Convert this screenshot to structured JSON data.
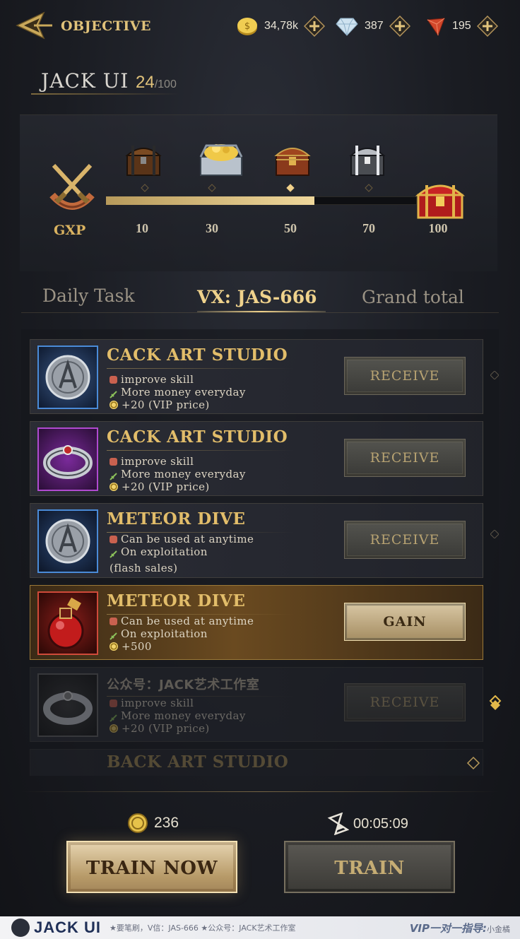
{
  "header": {
    "title": "OBJECTIVE",
    "currencies": [
      {
        "icon": "gold-coin-icon",
        "value": "34,78k"
      },
      {
        "icon": "diamond-icon",
        "value": "387"
      },
      {
        "icon": "red-gem-icon",
        "value": "195"
      }
    ]
  },
  "player": {
    "name": "JACK UI",
    "level": "24",
    "level_max": "/100"
  },
  "progress": {
    "label": "GXP",
    "fill_fraction": 0.67,
    "milestones": [
      "10",
      "30",
      "50",
      "70",
      "100"
    ]
  },
  "tabs": [
    {
      "label": "Daily Task",
      "active": false
    },
    {
      "label": "VX: JAS-666",
      "active": true
    },
    {
      "label": "Grand total",
      "active": false
    }
  ],
  "tasks": [
    {
      "title": "CACK ART STUDIO",
      "lines": [
        "improve skill",
        "More money everyday",
        "+20 (VIP price)"
      ],
      "button": "RECEIVE"
    },
    {
      "title": "CACK ART STUDIO",
      "lines": [
        "improve skill",
        "More money everyday",
        "+20 (VIP price)"
      ],
      "button": "RECEIVE"
    },
    {
      "title": "METEOR DIVE",
      "lines": [
        "Can be used at anytime",
        "On exploitation",
        "(flash sales)"
      ],
      "button": "RECEIVE"
    },
    {
      "title": "METEOR DIVE",
      "lines": [
        "Can be used at anytime",
        "On exploitation",
        "+500"
      ],
      "button": "GAIN"
    },
    {
      "title": "公众号：JACK艺术工作室",
      "lines": [
        "improve skill",
        "More money everyday",
        "+20 (VIP price)"
      ],
      "button": "RECEIVE"
    },
    {
      "title": "BACK ART STUDIO"
    }
  ],
  "bottom": {
    "cost": "236",
    "timer": "00:05:09",
    "train_now": "TRAIN NOW",
    "train": "TRAIN"
  },
  "footer": {
    "brand": "JACK UI",
    "text": "★要笔刷，V信：JAS-666  ★公众号：JACK艺术工作室",
    "vip": "VIP一对一指导:",
    "vip_name": "小金橘"
  }
}
